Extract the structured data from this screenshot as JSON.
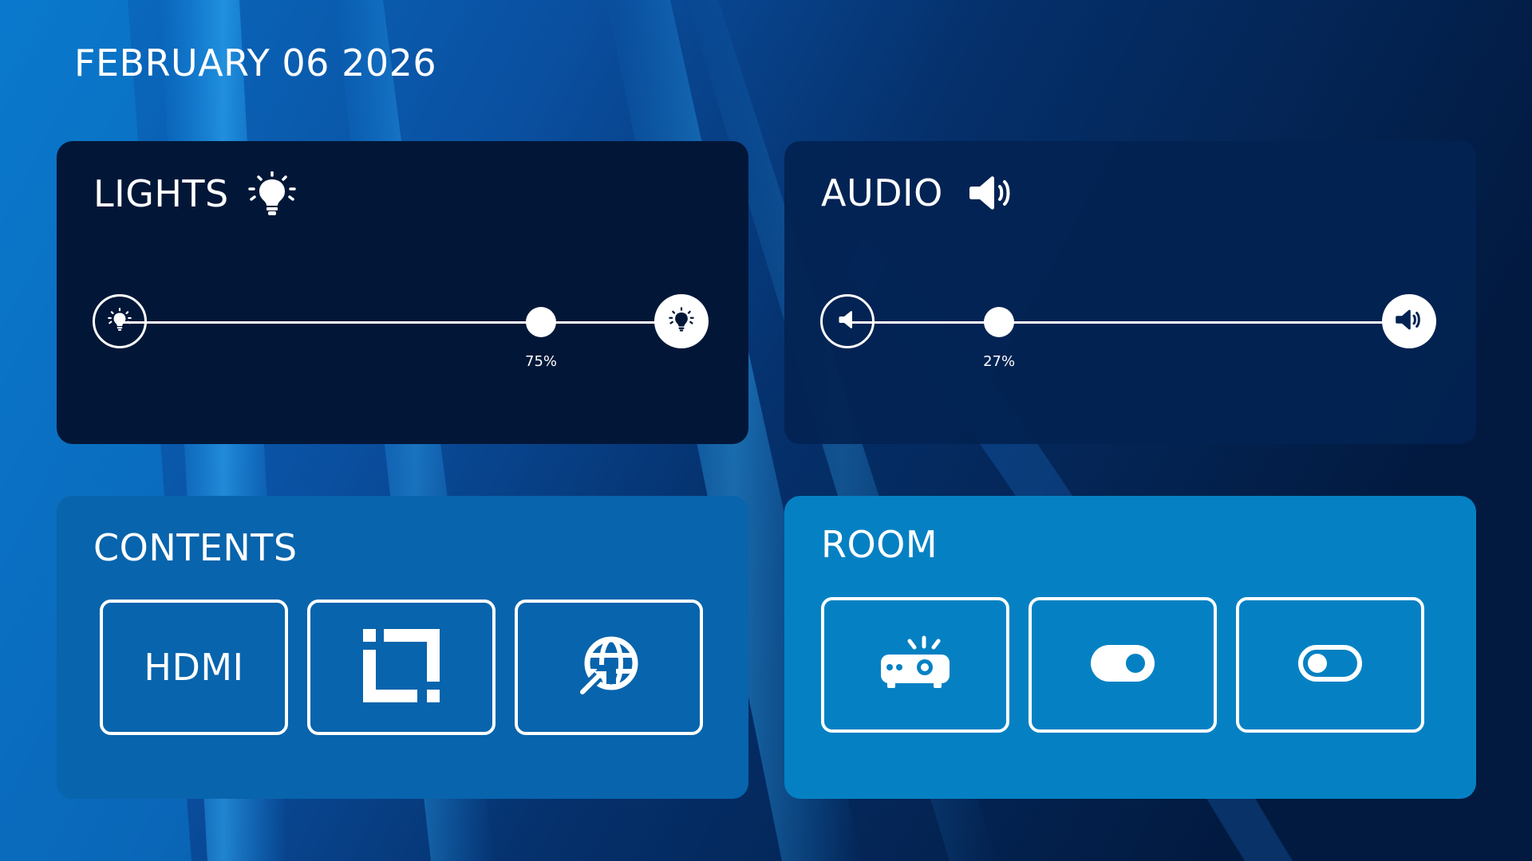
{
  "header": {
    "date": "FEBRUARY 06 2026"
  },
  "lights": {
    "title": "LIGHTS",
    "title_icon": "lightbulb-icon",
    "level": 75,
    "level_label": "75%",
    "min_icon": "lightbulb-dim-icon",
    "max_icon": "lightbulb-bright-icon"
  },
  "audio": {
    "title": "AUDIO",
    "title_icon": "speaker-icon",
    "level": 27,
    "level_label": "27%",
    "min_icon": "volume-down-icon",
    "max_icon": "volume-up-icon"
  },
  "contents": {
    "title": "CONTENTS",
    "tiles": [
      {
        "label": "HDMI"
      },
      {
        "icon": "screen-share-icon"
      },
      {
        "icon": "web-globe-icon"
      }
    ]
  },
  "room": {
    "title": "ROOM",
    "tiles": [
      {
        "icon": "projector-icon"
      },
      {
        "icon": "toggle-on-icon",
        "state": "on"
      },
      {
        "icon": "toggle-off-icon",
        "state": "off"
      }
    ]
  },
  "colors": {
    "lights_panel": "#021737",
    "audio_panel": "#022252",
    "contents_panel": "#0864ac",
    "room_panel": "#0581c3",
    "foreground": "#ffffff"
  }
}
